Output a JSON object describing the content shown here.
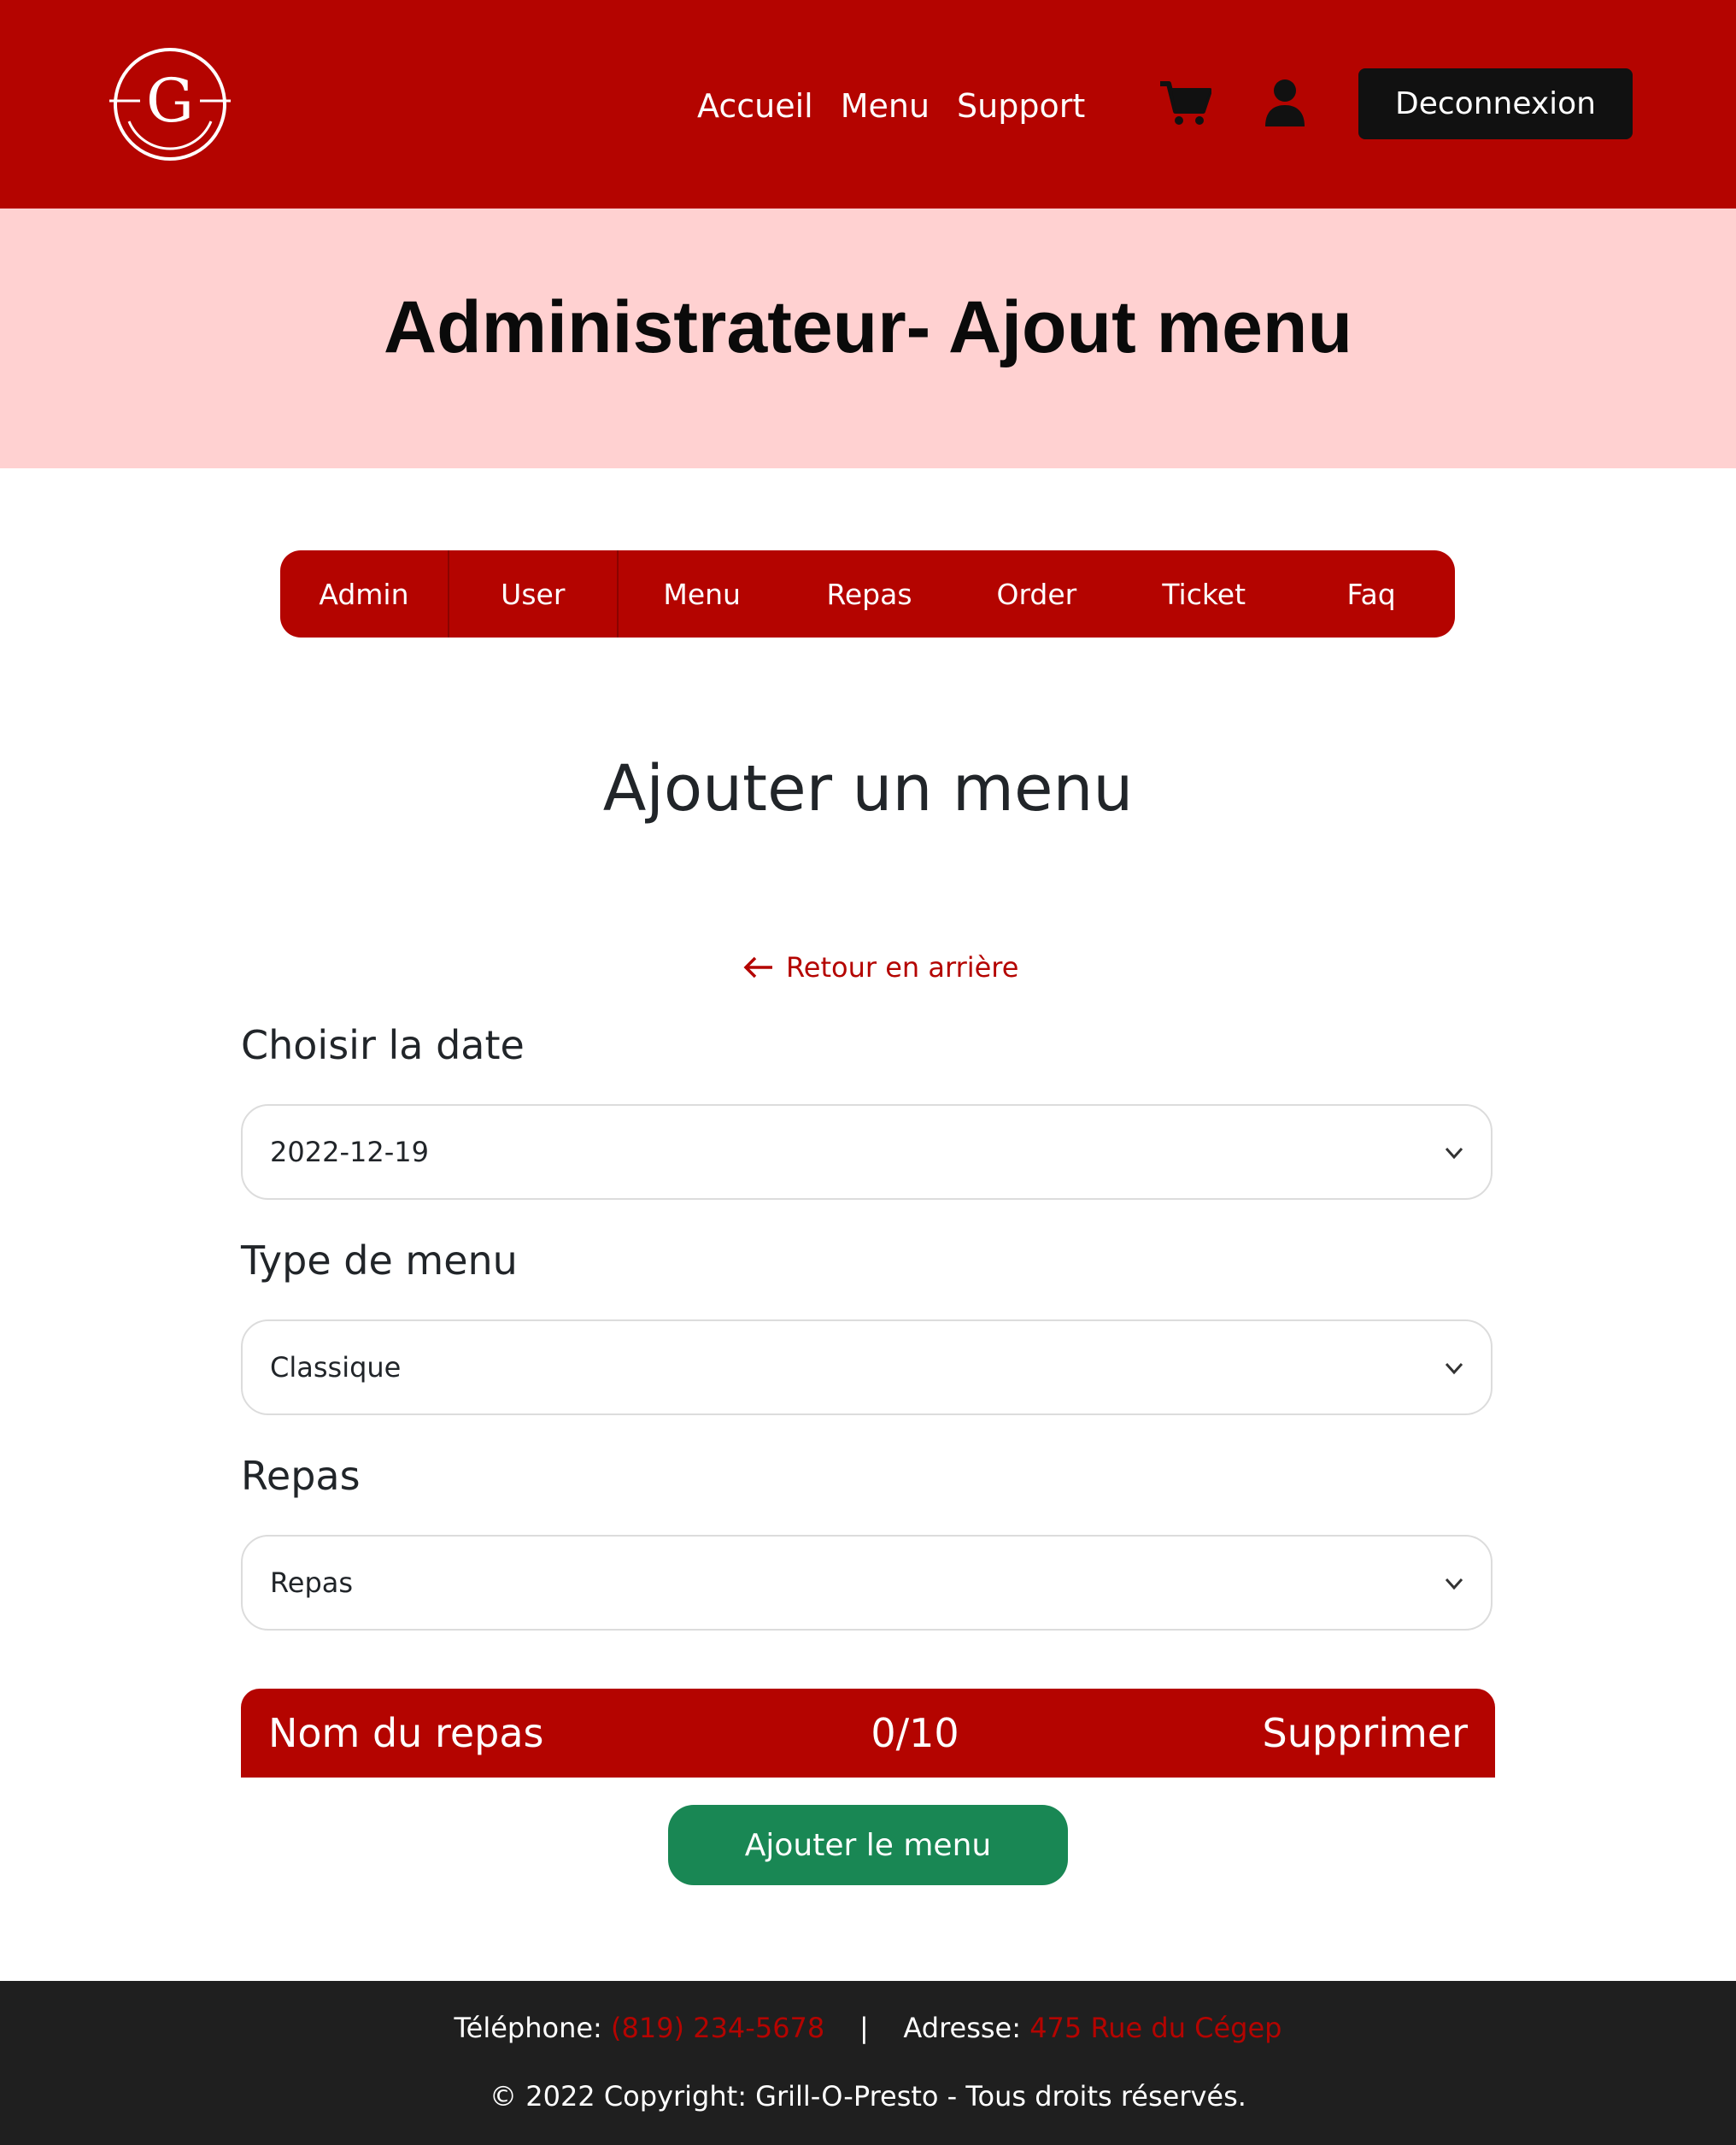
{
  "header": {
    "logo_letter": "G",
    "nav": [
      "Accueil",
      "Menu",
      "Support"
    ],
    "cart_icon": "shopping-cart-icon",
    "user_icon": "user-icon",
    "logout_label": "Deconnexion"
  },
  "hero": {
    "title": "Administrateur- Ajout menu"
  },
  "admin_tabs": [
    "Admin",
    "User",
    "Menu",
    "Repas",
    "Order",
    "Ticket",
    "Faq"
  ],
  "section_title": "Ajouter un menu",
  "back_link": {
    "icon": "arrow-left-icon",
    "label": "Retour en arrière"
  },
  "form": {
    "date": {
      "label": "Choisir la date",
      "value": "2022-12-19"
    },
    "menu_type": {
      "label": "Type de menu",
      "value": "Classique"
    },
    "meal": {
      "label": "Repas",
      "value": "Repas"
    }
  },
  "meal_table": {
    "header": {
      "name": "Nom du repas",
      "count": "0/10",
      "delete": "Supprimer"
    }
  },
  "submit_label": "Ajouter le menu",
  "footer": {
    "phone_label": "Téléphone:",
    "phone_value": "(819) 234-5678",
    "separator": "|",
    "address_label": "Adresse:",
    "address_value": "475 Rue du Cégep",
    "copyright": "© 2022 Copyright: Grill-O-Presto - Tous droits réservés."
  },
  "colors": {
    "brand_red": "#b40400",
    "hero_pink": "#ffd1d1",
    "success_green": "#198754",
    "footer_dark": "#1f1f1f"
  }
}
